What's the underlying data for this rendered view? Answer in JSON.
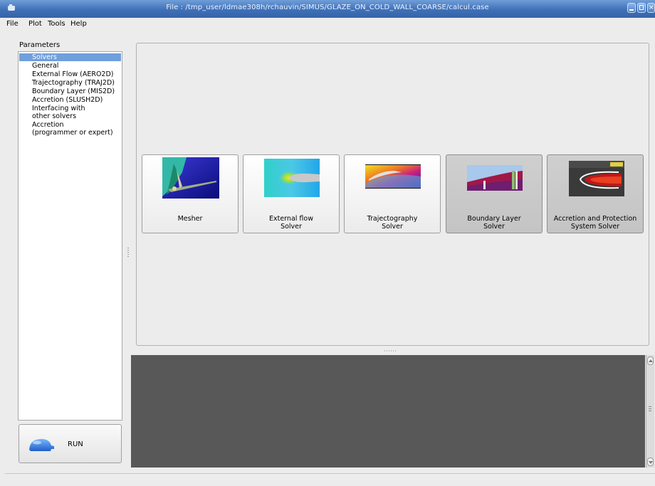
{
  "window": {
    "title": "File : /tmp_user/ldmae308h/rchauvin/SIMUS/GLAZE_ON_COLD_WALL_COARSE/calcul.case"
  },
  "menu": {
    "file": "File",
    "plot": "Plot",
    "tools": "Tools",
    "help": "Help"
  },
  "parameters": {
    "label": "Parameters",
    "items": [
      {
        "label": "Solvers"
      },
      {
        "label": "General"
      },
      {
        "label": "External Flow (AERO2D)"
      },
      {
        "label": "Trajectography (TRAJ2D)"
      },
      {
        "label": "Boundary Layer (MIS2D)"
      },
      {
        "label": "Accretion (SLUSH2D)"
      },
      {
        "label": "Interfacing with\nother solvers"
      },
      {
        "label": "Accretion\n(programmer or expert)"
      }
    ]
  },
  "run": {
    "label": "RUN"
  },
  "solvers": [
    {
      "label": "Mesher"
    },
    {
      "label": "External flow\nSolver"
    },
    {
      "label": "Trajectography\nSolver"
    },
    {
      "label": "Boundary Layer\nSolver"
    },
    {
      "label": "Accretion and Protection\nSystem Solver"
    }
  ]
}
